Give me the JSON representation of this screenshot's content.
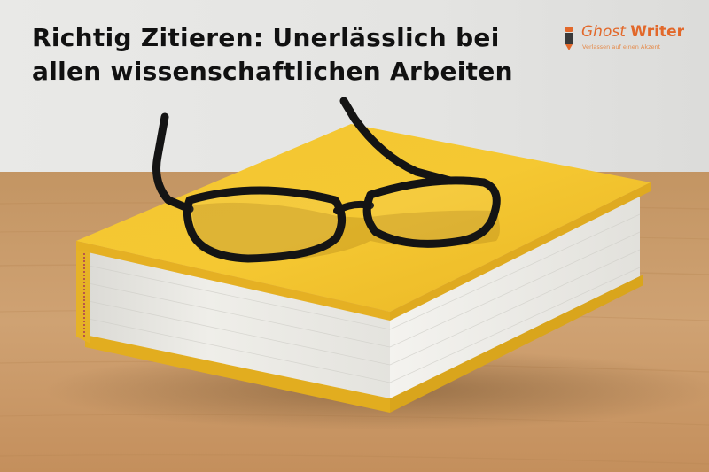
{
  "headline": {
    "line1": "Richtig Zitieren: Unerlässlich bei",
    "line2": "allen wissenschaftlichen Arbeiten"
  },
  "logo": {
    "name_part1": "Ghost",
    "name_part2": "Writer",
    "tagline": "Verlassen auf einen Akzent",
    "accent_color": "#e2682a"
  },
  "photo": {
    "subject": "yellow-hardcover-book-with-black-glasses",
    "colors": {
      "wall": "#e8e8e6",
      "table": "#c79a68",
      "book_cover": "#f2c12e",
      "pages": "#f0efeb",
      "glasses": "#141414"
    }
  }
}
